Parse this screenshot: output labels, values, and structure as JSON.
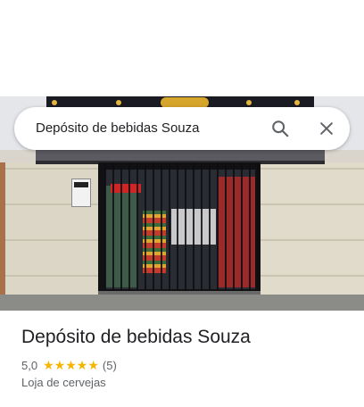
{
  "search": {
    "query": "Depósito de bebidas Souza",
    "search_icon": "search-icon",
    "close_icon": "close-icon"
  },
  "place": {
    "photo_description_icon": "storefront-photo",
    "name": "Depósito de bebidas Souza",
    "rating": "5,0",
    "stars": 5,
    "review_count": "(5)",
    "category": "Loja de cervejas"
  },
  "colors": {
    "star": "#f4b400",
    "title_text": "#202124",
    "secondary_text": "#5f6368"
  }
}
